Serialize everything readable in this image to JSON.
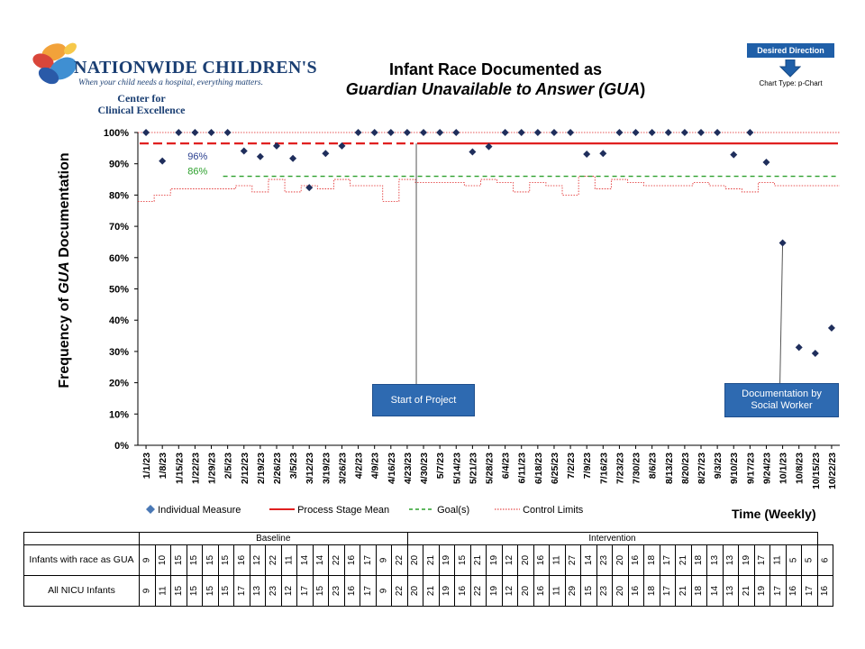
{
  "logo": {
    "name": "NATIONWIDE CHILDREN'S",
    "tagline": "When your child needs a hospital, everything matters.",
    "center_line1": "Center for",
    "center_line2": "Clinical Excellence"
  },
  "title": {
    "line1": "Infant Race Documented as",
    "line2": "Guardian Unavailable to Answer (GUA",
    "line2_close": ")"
  },
  "desired_direction": {
    "label": "Desired Direction",
    "icon": "down-arrow-icon"
  },
  "chart_type": "Chart Type: p-Chart",
  "legend": {
    "individual": "Individual Measure",
    "mean": "Process Stage Mean",
    "goal": "Goal(s)",
    "limits": "Control Limits"
  },
  "x_title": "Time (Weekly)",
  "annotations": {
    "start": "Start of Project",
    "social_line1": "Documentation by",
    "social_line2": "Social Worker"
  },
  "table": {
    "phase_baseline": "Baseline",
    "phase_intervention": "Intervention",
    "row1_label": "Infants with race as GUA",
    "row2_label": "All NICU Infants",
    "numerators": [
      9,
      10,
      15,
      15,
      15,
      15,
      16,
      12,
      22,
      11,
      14,
      14,
      22,
      16,
      17,
      9,
      22,
      20,
      21,
      19,
      15,
      21,
      19,
      12,
      20,
      16,
      11,
      27,
      14,
      23,
      20,
      16,
      18,
      17,
      21,
      18,
      13,
      13,
      19,
      17,
      11,
      5,
      5,
      6
    ],
    "denominators": [
      9,
      11,
      15,
      15,
      15,
      15,
      17,
      13,
      23,
      12,
      17,
      15,
      23,
      16,
      17,
      9,
      22,
      20,
      21,
      19,
      16,
      22,
      19,
      12,
      20,
      16,
      11,
      29,
      15,
      23,
      20,
      16,
      18,
      17,
      21,
      18,
      14,
      13,
      21,
      19,
      17,
      16,
      17,
      16
    ]
  },
  "chart_data": {
    "type": "line",
    "ylabel": "Frequency of GUA Documentation",
    "ylabel_parts": [
      "Frequency of ",
      "GUA",
      " Documentation"
    ],
    "xlabel": "Time (Weekly)",
    "ylim": [
      0,
      1
    ],
    "y_ticks": [
      "0%",
      "10%",
      "20%",
      "30%",
      "40%",
      "50%",
      "60%",
      "70%",
      "80%",
      "90%",
      "100%"
    ],
    "x": [
      "1/1/23",
      "1/8/23",
      "1/15/23",
      "1/22/23",
      "1/29/23",
      "2/5/23",
      "2/12/23",
      "2/19/23",
      "2/26/23",
      "3/5/23",
      "3/12/23",
      "3/19/23",
      "3/26/23",
      "4/2/23",
      "4/9/23",
      "4/16/23",
      "4/23/23",
      "4/30/23",
      "5/7/23",
      "5/14/23",
      "5/21/23",
      "5/28/23",
      "6/4/23",
      "6/11/23",
      "6/18/23",
      "6/25/23",
      "7/2/23",
      "7/9/23",
      "7/16/23",
      "7/23/23",
      "7/30/23",
      "8/6/23",
      "8/13/23",
      "8/20/23",
      "8/27/23",
      "9/3/23",
      "9/10/23",
      "9/17/23",
      "9/24/23",
      "10/1/23",
      "10/8/23",
      "10/15/23",
      "10/22/23"
    ],
    "series": [
      {
        "name": "Individual Measure",
        "values": [
          1.0,
          0.909,
          1.0,
          1.0,
          1.0,
          1.0,
          0.941,
          0.923,
          0.957,
          0.917,
          0.824,
          0.933,
          0.957,
          1.0,
          1.0,
          1.0,
          1.0,
          1.0,
          1.0,
          1.0,
          0.938,
          0.955,
          1.0,
          1.0,
          1.0,
          1.0,
          1.0,
          0.931,
          0.933,
          1.0,
          1.0,
          1.0,
          1.0,
          1.0,
          1.0,
          1.0,
          0.929,
          1.0,
          0.905,
          0.647,
          0.313,
          0.294,
          0.375
        ]
      }
    ],
    "process_mean": [
      {
        "label": "96%",
        "value": 0.965,
        "from": "1/1/23",
        "to": "4/23/23"
      },
      {
        "value": 0.965,
        "from": "4/30/23",
        "to": "10/22/23"
      }
    ],
    "goal": {
      "label": "86%",
      "value": 0.86,
      "from": "2/5/23",
      "to": "10/22/23"
    },
    "upper_control_limit": 1.0,
    "lower_control_limit": [
      0.78,
      0.8,
      0.82,
      0.82,
      0.82,
      0.82,
      0.83,
      0.81,
      0.85,
      0.81,
      0.83,
      0.82,
      0.85,
      0.83,
      0.83,
      0.78,
      0.85,
      0.84,
      0.84,
      0.84,
      0.83,
      0.85,
      0.84,
      0.81,
      0.84,
      0.83,
      0.8,
      0.86,
      0.82,
      0.85,
      0.84,
      0.83,
      0.83,
      0.83,
      0.84,
      0.83,
      0.82,
      0.81,
      0.84,
      0.83,
      0.83,
      0.83,
      0.83
    ],
    "events": [
      {
        "at": "4/30/23",
        "label": "Start of Project"
      },
      {
        "at": "10/1/23",
        "label": "Documentation by Social Worker"
      }
    ],
    "colors": {
      "points": "#1f2e5c",
      "mean": "#e02020",
      "goal": "#2ca02c",
      "limits": "#e02020",
      "mean_label": "#2a3f8f",
      "goal_label": "#2ca02c"
    }
  }
}
